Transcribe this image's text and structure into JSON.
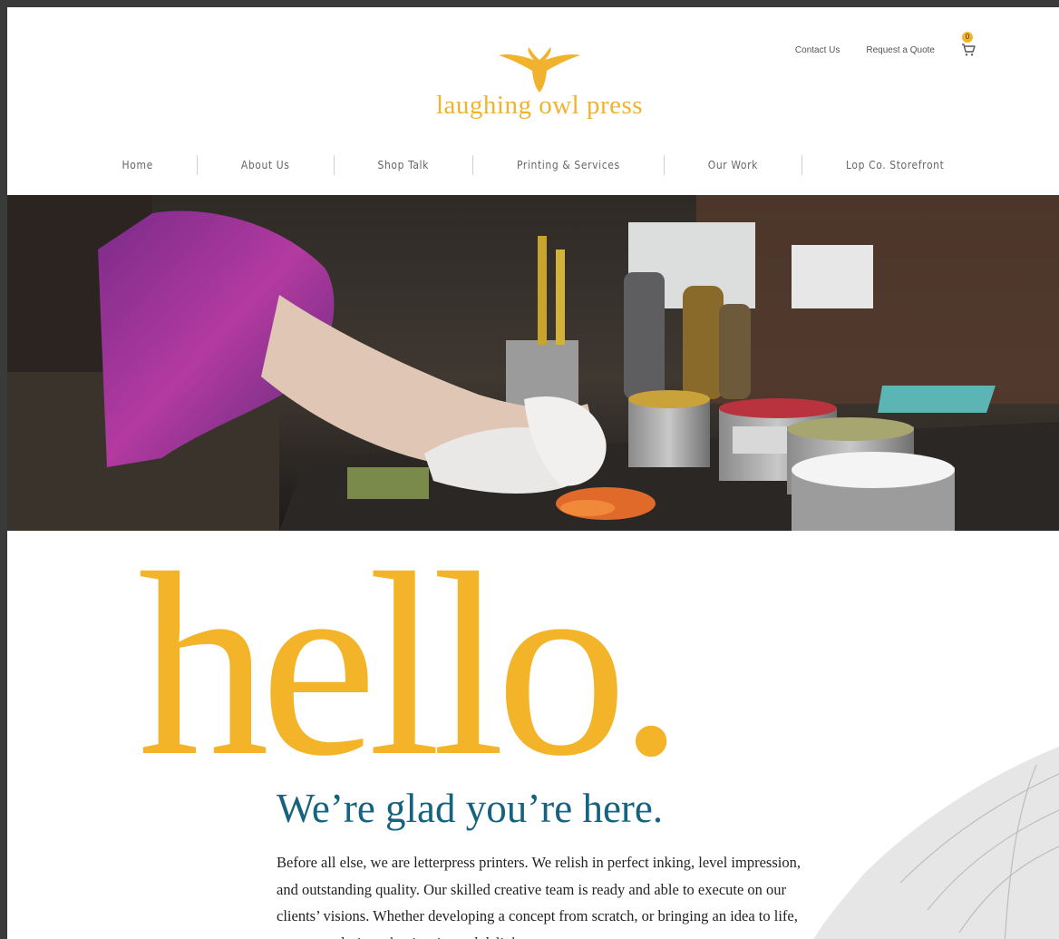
{
  "header": {
    "utility_links": {
      "contact": "Contact Us",
      "quote": "Request a Quote"
    },
    "cart": {
      "icon": "cart-icon",
      "count": "0"
    },
    "logo": {
      "text": "laughing owl press",
      "icon": "owl-icon",
      "color": "#f1b22e"
    }
  },
  "nav": {
    "items": [
      {
        "label": "Home"
      },
      {
        "label": "About Us"
      },
      {
        "label": "Shop Talk"
      },
      {
        "label": "Printing & Services"
      },
      {
        "label": "Our Work"
      },
      {
        "label": "Lop Co. Storefront"
      }
    ]
  },
  "hero": {
    "icon": "hero-photo"
  },
  "intro": {
    "hello": "hello.",
    "subheading": "We’re glad you’re here.",
    "paragraph": "Before all else, we are letterpress printers. We relish in perfect inking, level impression, and outstanding quality. Our skilled creative team is ready and able to execute on our clients’ visions. Whether developing a concept from scratch, or bringing an idea to life, we create designs that inspire and delight."
  },
  "colors": {
    "accent": "#f4b42a",
    "heading": "#17637f",
    "text": "#222222"
  }
}
